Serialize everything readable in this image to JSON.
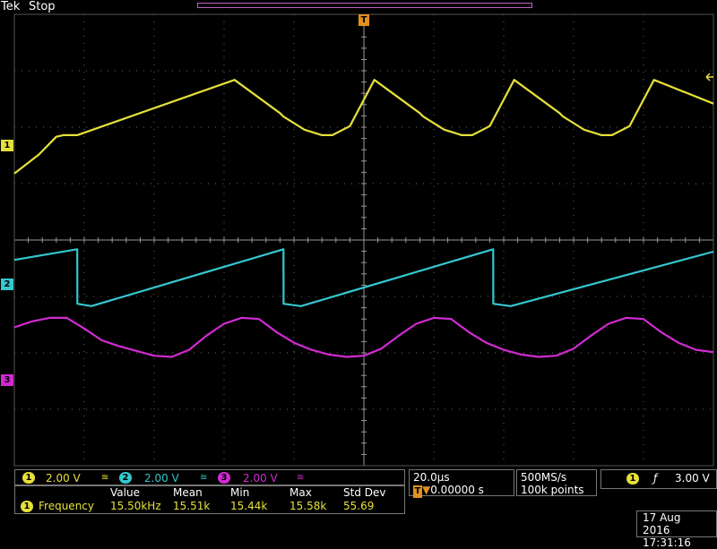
{
  "header": {
    "brand": "Tek",
    "state": "Stop"
  },
  "colors": {
    "ch1": "#e6e03a",
    "ch2": "#35c7d0",
    "ch3": "#d22ad2",
    "grid": "#6a6a6a",
    "background": "#000000"
  },
  "markers": {
    "ch1": "1",
    "ch2": "2",
    "ch3": "3",
    "trigger": "T",
    "trigger_level_icon": "arrow-left-icon"
  },
  "channels": [
    {
      "id": "1",
      "scale": "2.00 V",
      "bw_icon": "bandwidth-limit-icon"
    },
    {
      "id": "2",
      "scale": "2.00 V",
      "bw_icon": "bandwidth-limit-icon"
    },
    {
      "id": "3",
      "scale": "2.00 V",
      "bw_icon": "bandwidth-limit-icon"
    }
  ],
  "horizontal": {
    "scale": "20.0µs",
    "trigger_position": "0.00000 s"
  },
  "acquisition": {
    "rate": "500MS/s",
    "points": "100k points"
  },
  "trigger": {
    "source": "1",
    "slope_icon": "rising-edge-icon",
    "level": "3.00 V"
  },
  "measurement": {
    "headers": [
      "Value",
      "Mean",
      "Min",
      "Max",
      "Std Dev"
    ],
    "channel": "1",
    "name": "Frequency",
    "values": [
      "15.50kHz",
      "15.51k",
      "15.44k",
      "15.58k",
      "55.69"
    ]
  },
  "datetime": {
    "date": "17 Aug 2016",
    "time": "17:31:16"
  },
  "chart_data": {
    "type": "line",
    "grid": {
      "divisions_x": 10,
      "divisions_y": 8
    },
    "series": [
      {
        "channel": "1",
        "x_div": [
          0.0,
          0.35,
          0.6,
          0.7,
          0.9,
          3.15,
          3.8,
          3.85,
          4.15,
          4.4,
          4.55,
          4.8,
          5.15,
          5.8,
          5.85,
          6.15,
          6.4,
          6.55,
          6.8,
          7.15,
          7.8,
          7.85,
          8.15,
          8.4,
          8.55,
          8.8,
          9.15,
          10.0
        ],
        "y_div": [
          -1.2,
          -0.4,
          0.35,
          0.42,
          0.42,
          2.75,
          1.35,
          1.2,
          0.65,
          0.42,
          0.42,
          0.8,
          2.75,
          1.35,
          1.2,
          0.65,
          0.42,
          0.42,
          0.8,
          2.75,
          1.35,
          1.2,
          0.65,
          0.42,
          0.42,
          0.8,
          2.75,
          1.75
        ]
      },
      {
        "channel": "2",
        "x_div": [
          0.0,
          0.9,
          0.901,
          1.1,
          3.85,
          3.851,
          4.1,
          6.85,
          6.851,
          7.1,
          10.0
        ],
        "y_div": [
          1.05,
          1.5,
          -0.8,
          -0.9,
          1.5,
          -0.8,
          -0.9,
          1.5,
          -0.8,
          -0.9,
          1.4
        ]
      },
      {
        "channel": "3",
        "x_div": [
          0.0,
          0.25,
          0.5,
          0.75,
          1.0,
          1.25,
          1.5,
          1.75,
          2.0,
          2.25,
          2.5,
          2.75,
          3.0,
          3.25,
          3.5,
          3.75,
          4.0,
          4.25,
          4.5,
          4.75,
          5.0,
          5.25,
          5.5,
          5.75,
          6.0,
          6.25,
          6.5,
          6.75,
          7.0,
          7.25,
          7.5,
          7.75,
          8.0,
          8.25,
          8.5,
          8.75,
          9.0,
          9.25,
          9.5,
          9.75,
          10.0
        ],
        "y_div": [
          2.25,
          2.5,
          2.65,
          2.65,
          2.2,
          1.7,
          1.45,
          1.25,
          1.05,
          1.0,
          1.3,
          1.9,
          2.4,
          2.65,
          2.6,
          2.05,
          1.6,
          1.3,
          1.1,
          1.0,
          1.05,
          1.35,
          1.9,
          2.4,
          2.65,
          2.6,
          2.05,
          1.6,
          1.3,
          1.1,
          1.0,
          1.05,
          1.35,
          1.9,
          2.4,
          2.65,
          2.6,
          2.05,
          1.6,
          1.3,
          1.2
        ]
      }
    ]
  }
}
